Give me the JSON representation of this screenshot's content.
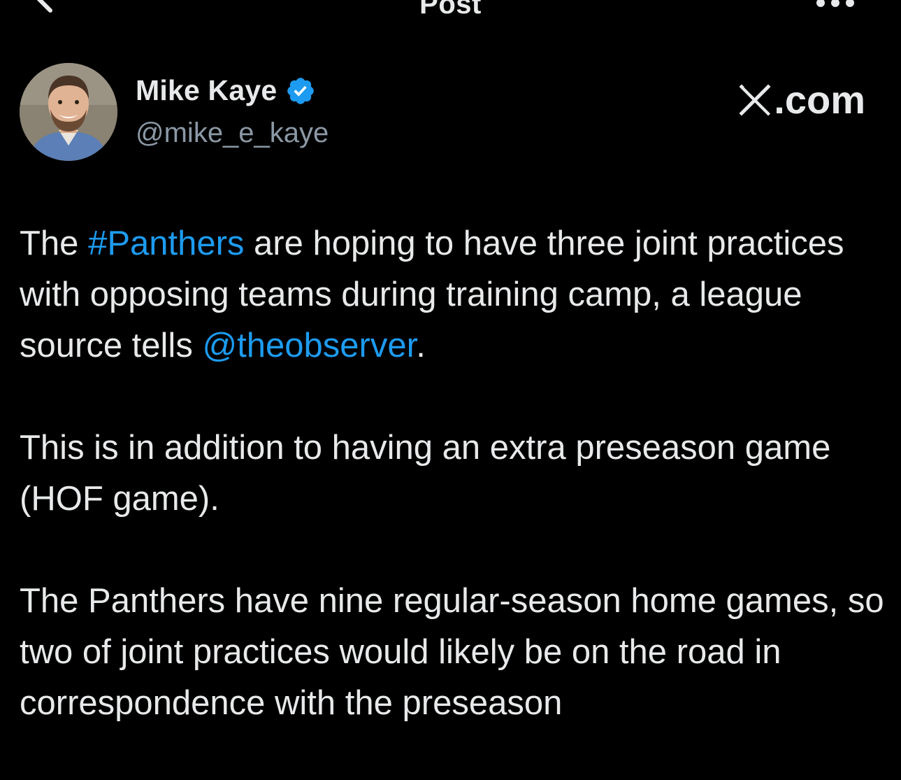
{
  "topbar": {
    "title": "Post",
    "back_icon": "arrow-left-icon",
    "more_icon": "more-dots-icon"
  },
  "author": {
    "display_name": "Mike Kaye",
    "handle": "@mike_e_kaye",
    "verified_icon": "verified-badge-icon",
    "avatar": "avatar-photo"
  },
  "brand": {
    "text": ".com",
    "logo_icon": "x-logo-icon"
  },
  "post": {
    "p1": {
      "t1": "The ",
      "hashtag": "#Panthers",
      "t2": " are hoping to have three joint practices with opposing teams during training camp, a league source tells ",
      "mention": "@theobserver",
      "t3": "."
    },
    "p2": "This is in addition to having an extra preseason game (HOF game).",
    "p3": "The Panthers have nine regular-season home games, so two of joint practices would likely be on the road in correspondence with the preseason"
  },
  "colors": {
    "background": "#000000",
    "text": "#e7e9ea",
    "secondary_text": "#8b98a5",
    "link": "#1d9bf0",
    "verified": "#1d9bf0"
  }
}
